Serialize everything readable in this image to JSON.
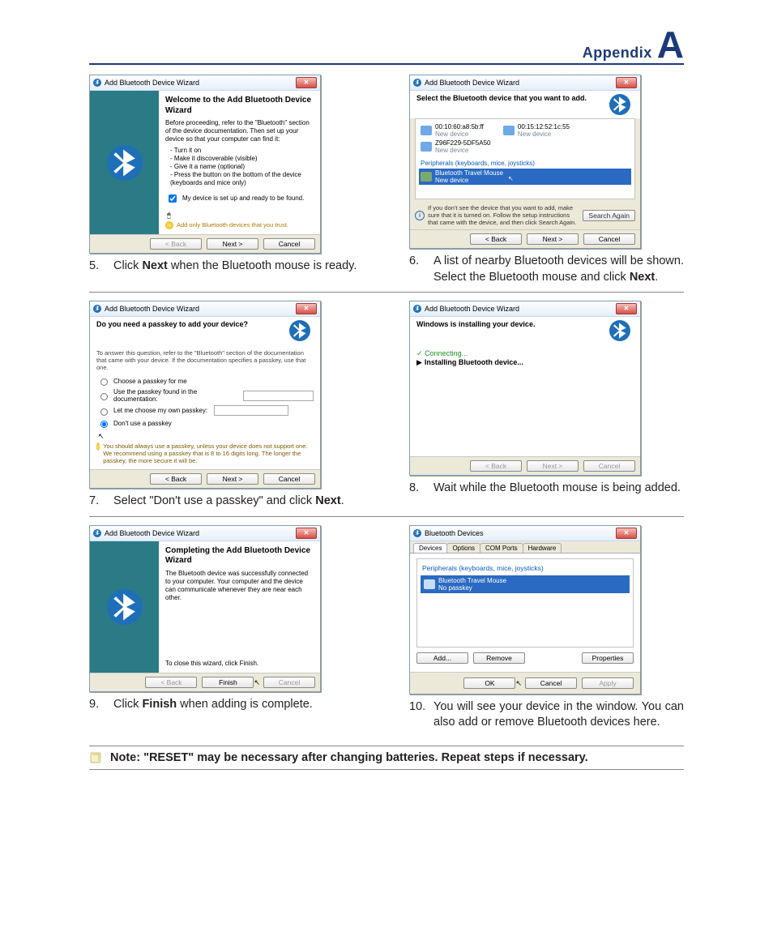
{
  "header": {
    "label": "Appendix",
    "letter": "A"
  },
  "wiz5": {
    "title": "Add Bluetooth Device Wizard",
    "h1": "Welcome to the Add Bluetooth Device Wizard",
    "p1": "Before proceeding, refer to the \"Bluetooth\" section of the device documentation. Then set up your device so that your computer can find it:",
    "b1": "- Turn it on",
    "b2": "- Make it discoverable (visible)",
    "b3": "- Give it a name (optional)",
    "b4": "- Press the button on the bottom of the device (keyboards and mice only)",
    "chk": "My device is set up and ready to be found.",
    "warn": "Add only Bluetooth devices that you trust.",
    "back": "< Back",
    "next": "Next >",
    "cancel": "Cancel"
  },
  "step5": {
    "num": "5.",
    "pre": "Click ",
    "bold": "Next",
    "post": " when the Bluetooth mouse is ready."
  },
  "wiz6": {
    "title": "Add Bluetooth Device Wizard",
    "prompt": "Select the Bluetooth device that you want to add.",
    "dev1": "00:10:60:a8:5b:ff",
    "dev1s": "New device",
    "dev2": "00:15:12:52:1c:55",
    "dev2s": "New device",
    "dev3": "Z96F229-5DF5A50",
    "dev3s": "New device",
    "grp": "Peripherals (keyboards, mice, joysticks)",
    "dev4": "Bluetooth Travel Mouse",
    "dev4s": "New device",
    "info": "If you don't see the device that you want to add, make sure that it is turned on. Follow the setup instructions that came with the device, and then click Search Again.",
    "search": "Search Again",
    "back": "< Back",
    "next": "Next >",
    "cancel": "Cancel"
  },
  "step6": {
    "num": "6.",
    "txt": "A list of nearby Bluetooth devices will be shown. Select the Bluetooth mouse and click ",
    "bold": "Next",
    "post": "."
  },
  "wiz7": {
    "title": "Add Bluetooth Device Wizard",
    "q": "Do you need a passkey to add your device?",
    "tip": "To answer this question, refer to the \"Bluetooth\" section of the documentation that came with your device. If the documentation specifies a passkey, use that one.",
    "r1": "Choose a passkey for me",
    "r2": "Use the passkey found in the documentation:",
    "r3": "Let me choose my own passkey:",
    "r4": "Don't use a passkey",
    "warn": "You should always use a passkey, unless your device does not support one. We recommend using a passkey that is 8 to 16 digits long. The longer the passkey, the more secure it will be.",
    "back": "< Back",
    "next": "Next >",
    "cancel": "Cancel"
  },
  "step7": {
    "num": "7.",
    "pre": "Select \"Don't use a passkey\" and click ",
    "bold": "Next",
    "post": "."
  },
  "wiz8": {
    "title": "Add Bluetooth Device Wizard",
    "h": "Windows is installing your device.",
    "l1": "Connecting...",
    "l2": "Installing Bluetooth device...",
    "back": "< Back",
    "next": "Next >",
    "cancel": "Cancel"
  },
  "step8": {
    "num": "8.",
    "txt": "Wait while the Bluetooth mouse is being added."
  },
  "wiz9": {
    "title": "Add Bluetooth Device Wizard",
    "h1": "Completing the Add Bluetooth Device Wizard",
    "p1": "The Bluetooth device was successfully connected to your computer. Your computer and the device can communicate whenever they are near each other.",
    "p2": "To close this wizard, click Finish.",
    "back": "< Back",
    "finish": "Finish",
    "cancel": "Cancel"
  },
  "step9": {
    "num": "9.",
    "pre": "Click ",
    "bold": "Finish",
    "post": " when adding is complete."
  },
  "dev10": {
    "title": "Bluetooth Devices",
    "tabs": [
      "Devices",
      "Options",
      "COM Ports",
      "Hardware"
    ],
    "grp": "Peripherals (keyboards, mice, joysticks)",
    "item": "Bluetooth Travel Mouse",
    "item_sub": "No passkey",
    "add": "Add...",
    "remove": "Remove",
    "props": "Properties",
    "ok": "OK",
    "cancel": "Cancel",
    "apply": "Apply"
  },
  "step10": {
    "num": "10.",
    "txt": "You will see your device in the window. You can also add or remove Bluetooth devices here."
  },
  "note": "Note: \"RESET\" may be necessary after changing batteries. Repeat steps if necessary."
}
